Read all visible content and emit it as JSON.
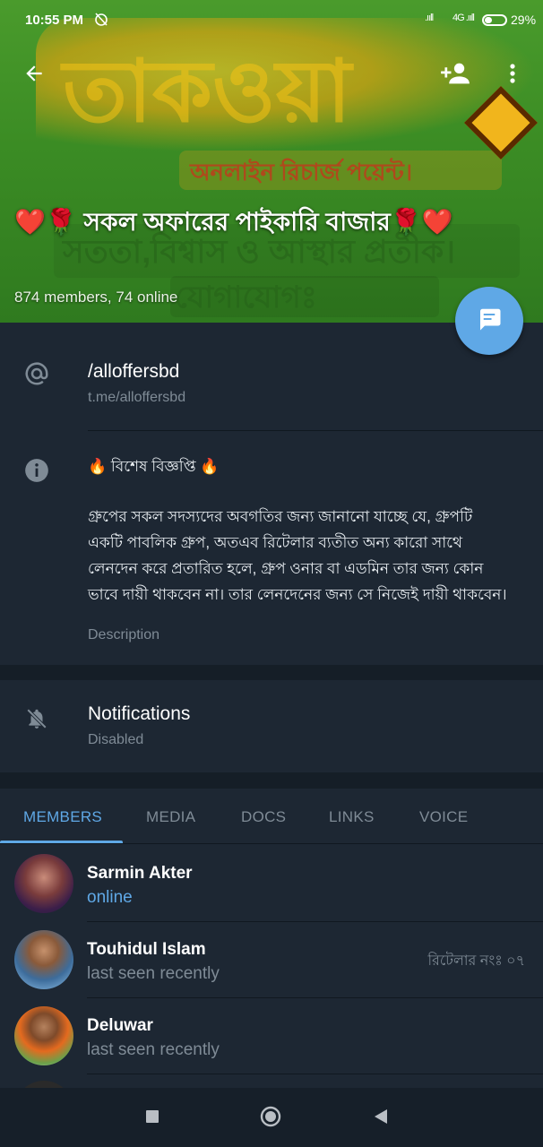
{
  "status_bar": {
    "time": "10:55 PM",
    "network_1": ".ııll",
    "network_2": "4G .ııll",
    "battery": "29%"
  },
  "header": {
    "title": "❤️🌹 সকল অফারের পাইকারি বাজার🌹❤️",
    "members_info": "874 members, 74 online",
    "banner_text": {
      "main": "তাকওয়া",
      "sub": "অনলাইন রিচার্জ পয়েন্ট।",
      "slogan": "সততা,বিশ্বাস ও আস্থার প্রতীক।",
      "contact": "যোগাযোগঃ"
    }
  },
  "info": {
    "username": "/alloffersbd",
    "link": "t.me/alloffersbd",
    "description_title": "🔥 বিশেষ বিজ্ঞপ্তি 🔥",
    "description_body": "গ্রুপের সকল সদস্যদের অবগতির জন্য জানানো যাচ্ছে যে, গ্রুপটি একটি পাবলিক গ্রুপ, অতএব রিটেলার ব্যতীত অন্য কারো সাথে লেনদেন করে প্রতারিত হলে, গ্রুপ ওনার বা এডমিন তার জন্য কোন ভাবে দায়ী থাকবেন না। তার লেনদেনের জন্য সে নিজেই দায়ী থাকবেন।",
    "description_label": "Description"
  },
  "notifications": {
    "title": "Notifications",
    "state": "Disabled"
  },
  "tabs": [
    "MEMBERS",
    "MEDIA",
    "DOCS",
    "LINKS",
    "VOICE"
  ],
  "members": [
    {
      "name": "Sarmin Akter",
      "status": "online",
      "role": ""
    },
    {
      "name": "Touhidul Islam",
      "status": "last seen recently",
      "role": "রিটেলার নংঃ ০৭"
    },
    {
      "name": "Deluwar",
      "status": "last seen recently",
      "role": ""
    }
  ],
  "colors": {
    "accent": "#5fa8e6",
    "background": "#1d2733",
    "muted": "#7f8b96"
  }
}
